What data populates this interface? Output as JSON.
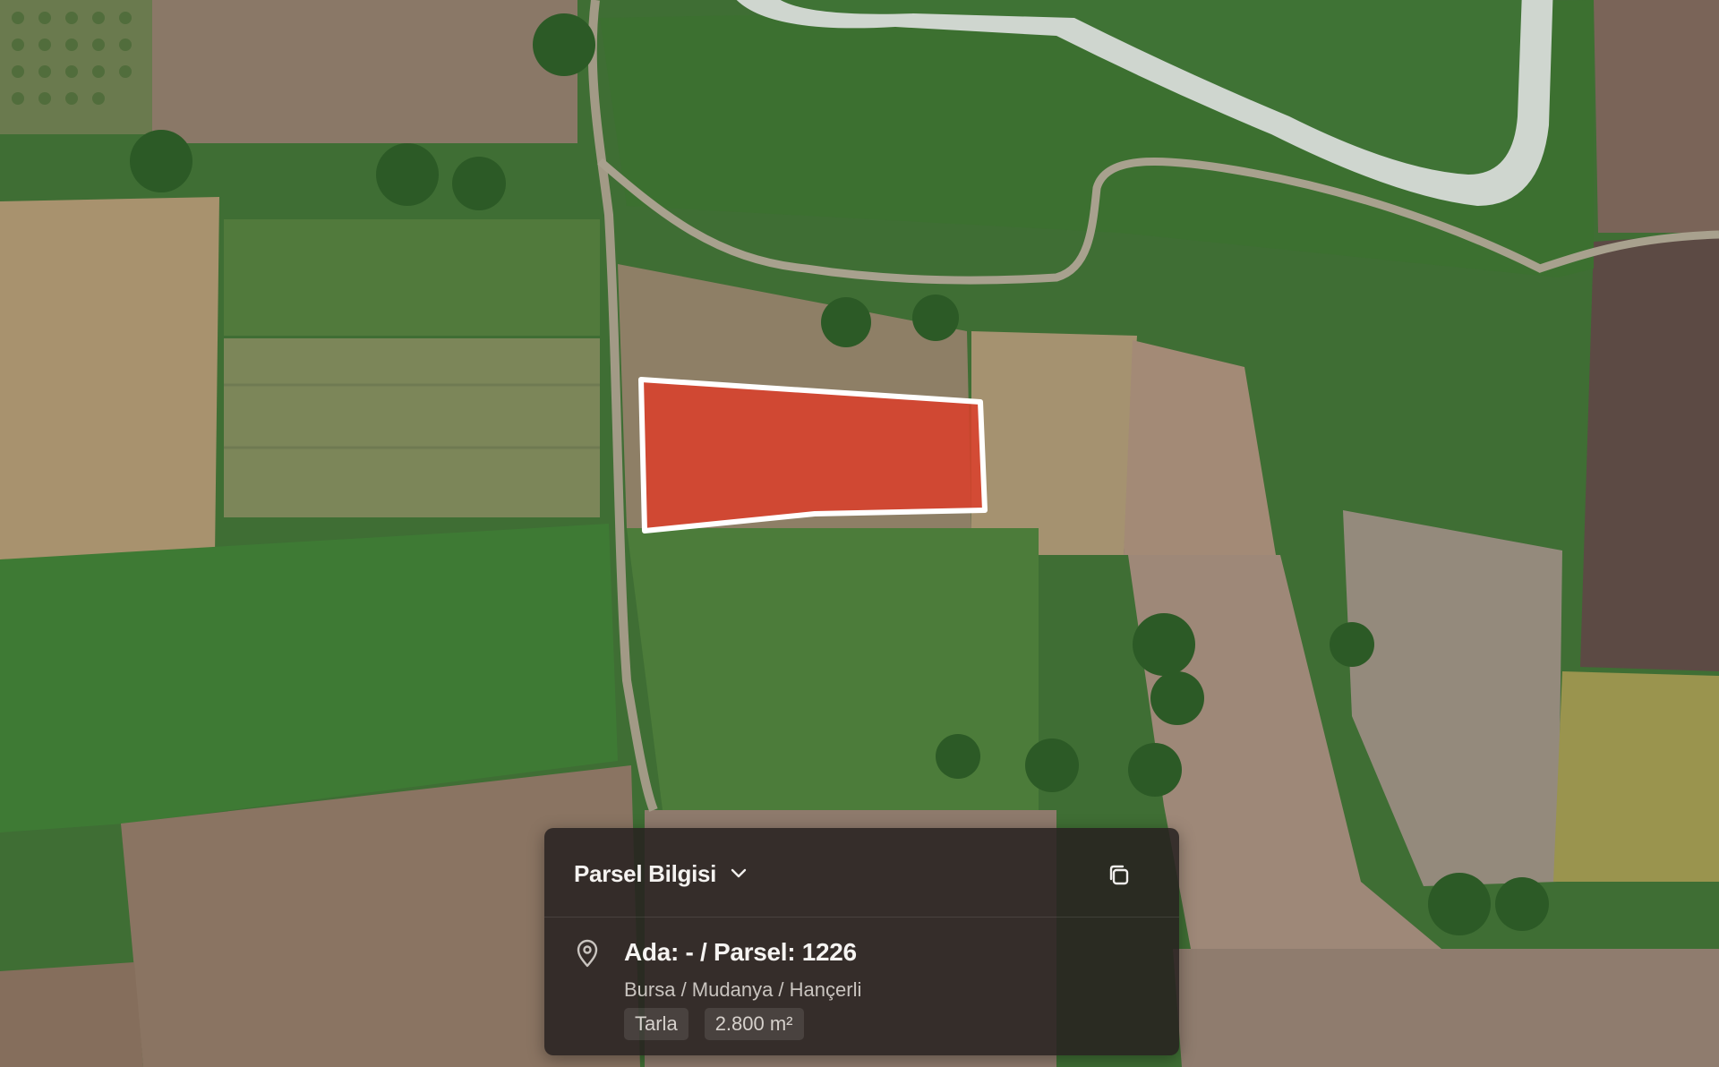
{
  "panel": {
    "title": "Parsel Bilgisi",
    "parcel_title": "Ada: - / Parsel: 1226",
    "location": "Bursa / Mudanya / Hançerli",
    "land_type": "Tarla",
    "area": "2.800 m²"
  },
  "icons": {
    "dropdown": "chevron-down-icon",
    "copy": "copy-icon",
    "location": "map-pin-icon"
  },
  "colors": {
    "parcel_fill": "#d9412c",
    "parcel_outline": "#ffffff",
    "panel_bg": "#26211f"
  }
}
